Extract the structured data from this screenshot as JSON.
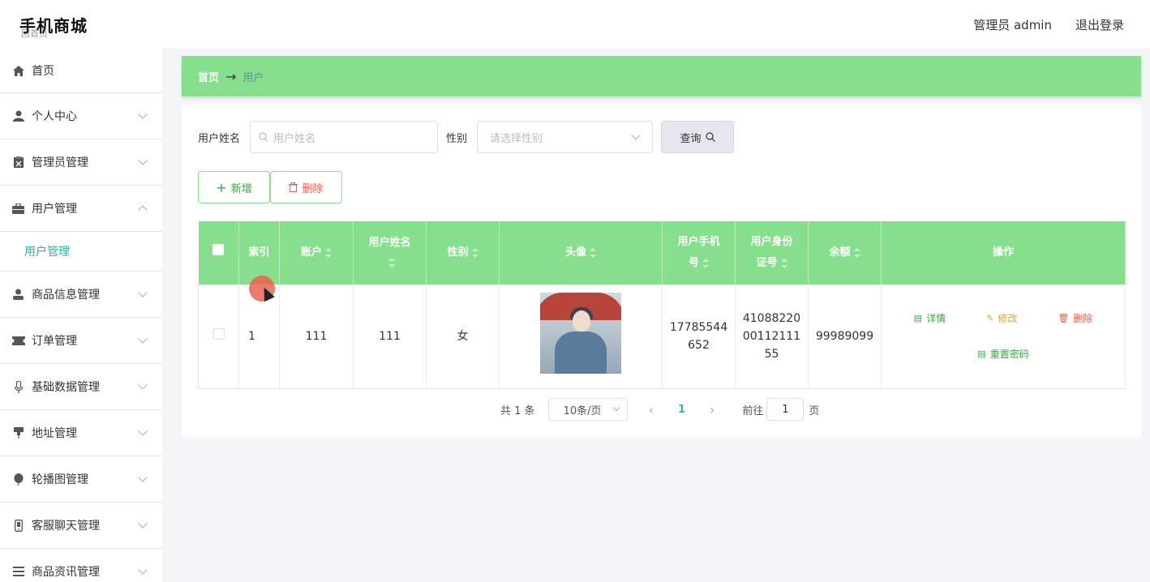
{
  "header": {
    "app_title": "手机商城",
    "app_sub": "回首页",
    "admin_label": "管理员 admin",
    "logout": "退出登录"
  },
  "sidebar": {
    "items": [
      {
        "label": "首页",
        "icon": "home-icon"
      },
      {
        "label": "个人中心",
        "icon": "user-icon"
      },
      {
        "label": "管理员管理",
        "icon": "clipboard-icon"
      },
      {
        "label": "用户管理",
        "icon": "briefcase-icon",
        "expanded": true
      },
      {
        "label": "用户管理",
        "icon": "",
        "sub": true,
        "active": true
      },
      {
        "label": "商品信息管理",
        "icon": "person-icon"
      },
      {
        "label": "订单管理",
        "icon": "ticket-icon"
      },
      {
        "label": "基础数据管理",
        "icon": "microphone-icon"
      },
      {
        "label": "地址管理",
        "icon": "pin-icon"
      },
      {
        "label": "轮播图管理",
        "icon": "balloon-icon"
      },
      {
        "label": "客服聊天管理",
        "icon": "phone-icon"
      },
      {
        "label": "商品资讯管理",
        "icon": "list-icon"
      }
    ]
  },
  "breadcrumb": {
    "home": "首页",
    "arrow": "→",
    "current": "用户"
  },
  "search": {
    "name_label": "用户姓名",
    "name_placeholder": "用户姓名",
    "gender_label": "性别",
    "gender_placeholder": "请选择性别",
    "query_button": "查询"
  },
  "actions": {
    "add": "新增",
    "delete": "删除"
  },
  "table": {
    "columns": [
      "索引",
      "账户",
      "用户姓名",
      "性别",
      "头像",
      "用户手机号",
      "用户身份证号",
      "余额",
      "操作"
    ],
    "rows": [
      {
        "index": "1",
        "account": "111",
        "name": "111",
        "gender": "女",
        "phone": "17785544652",
        "phone_lines": [
          "17785544",
          "652"
        ],
        "id_card": "410882200011211155",
        "id_card_lines": [
          "41088220",
          "00112111",
          "55"
        ],
        "balance": "99989099",
        "ops": {
          "detail": "详情",
          "edit": "修改",
          "remove": "删除",
          "reset": "重置密码"
        }
      }
    ]
  },
  "pagination": {
    "total": "共 1 条",
    "page_size": "10条/页",
    "current_page": "1",
    "goto_label": "前往",
    "goto_value": "1",
    "page_suffix": "页"
  },
  "colors": {
    "accent_green": "#86df8c",
    "active_teal": "#2bb3a6",
    "danger": "#e0604c",
    "warning": "#e6a23c"
  }
}
